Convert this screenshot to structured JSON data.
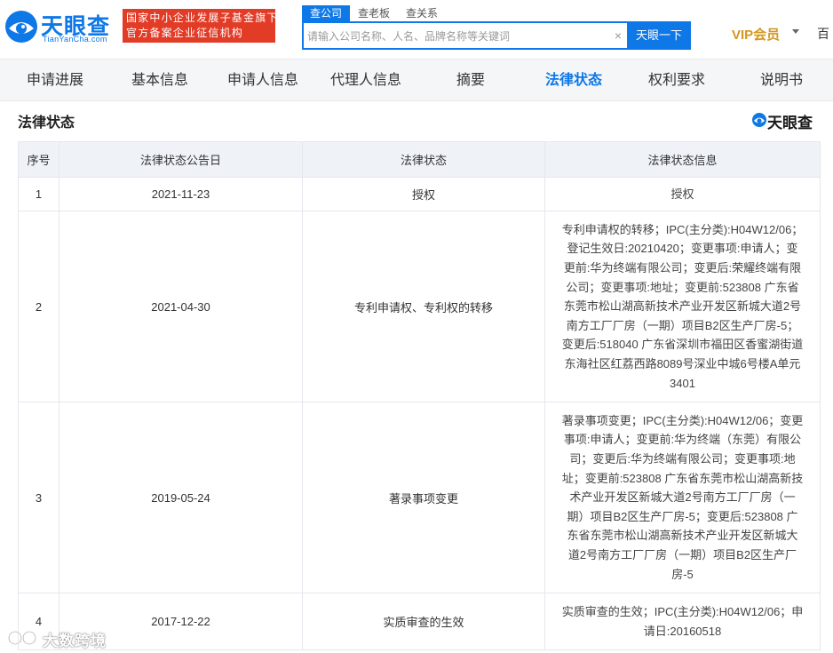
{
  "header": {
    "logo_text": "天眼查",
    "logo_sub": "TianYanCha.com",
    "badge_line1": "国家中小企业发展子基金旗下",
    "badge_line2": "官方备案企业征信机构",
    "search_tabs": [
      "查公司",
      "查老板",
      "查关系"
    ],
    "search_placeholder": "请输入公司名称、人名、品牌名称等关键词",
    "search_clear": "×",
    "search_button": "天眼一下",
    "vip_label": "VIP会员",
    "cut_text": "百"
  },
  "nav": {
    "items": [
      "申请进展",
      "基本信息",
      "申请人信息",
      "代理人信息",
      "摘要",
      "法律状态",
      "权利要求",
      "说明书"
    ],
    "active_index": 5
  },
  "section": {
    "title": "法律状态",
    "brand": "天眼查"
  },
  "table": {
    "headers": [
      "序号",
      "法律状态公告日",
      "法律状态",
      "法律状态信息"
    ],
    "rows": [
      {
        "no": "1",
        "date": "2021-11-23",
        "status": "授权",
        "info_lines": [
          "授权"
        ]
      },
      {
        "no": "2",
        "date": "2021-04-30",
        "status": "专利申请权、专利权的转移",
        "info_lines": [
          "专利申请权的转移；IPC(主分类):H04W12/06；",
          "登记生效日:20210420；变更事项:申请人；变",
          "更前:华为终端有限公司；变更后:荣耀终端有限",
          "公司；变更事项:地址；变更前:523808 广东省",
          "东莞市松山湖高新技术产业开发区新城大道2号",
          "南方工厂厂房（一期）项目B2区生产厂房-5；",
          "变更后:518040 广东省深圳市福田区香蜜湖街道",
          "东海社区红荔西路8089号深业中城6号楼A单元",
          "3401"
        ]
      },
      {
        "no": "3",
        "date": "2019-05-24",
        "status": "著录事项变更",
        "info_lines": [
          "著录事项变更；IPC(主分类):H04W12/06；变更",
          "事项:申请人；变更前:华为终端（东莞）有限公",
          "司；变更后:华为终端有限公司；变更事项:地",
          "址；变更前:523808 广东省东莞市松山湖高新技",
          "术产业开发区新城大道2号南方工厂厂房（一",
          "期）项目B2区生产厂房-5；变更后:523808 广",
          "东省东莞市松山湖高新技术产业开发区新城大",
          "道2号南方工厂厂房（一期）项目B2区生产厂",
          "房-5"
        ]
      },
      {
        "no": "4",
        "date": "2017-12-22",
        "status": "实质审查的生效",
        "info_lines": [
          "实质审查的生效；IPC(主分类):H04W12/06；申",
          "请日:20160518"
        ]
      }
    ]
  },
  "watermark": {
    "text": "大数跨境"
  },
  "colors": {
    "brand_blue": "#0e78e6",
    "badge_red": "#e23b26",
    "vip_gold": "#d4971e",
    "table_header_bg": "#eff3f8",
    "nav_bg": "#f5f6f8"
  }
}
